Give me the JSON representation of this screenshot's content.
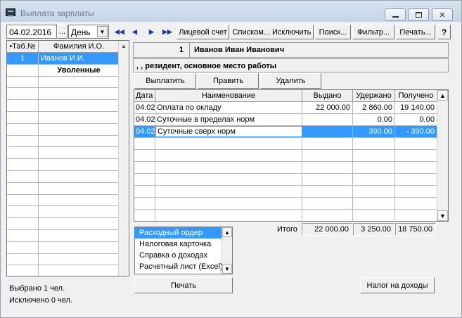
{
  "window": {
    "title": "Выплата зарплаты",
    "close_glyph": "✕"
  },
  "toolbar": {
    "date": "04.02.2016",
    "dots_label": "...",
    "period": "День",
    "nav_first": "◀◀",
    "nav_prev": "◀",
    "nav_next": "▶",
    "nav_last": "▶▶",
    "account_label": "Лицевой счет",
    "list_label": "Списком... Исключить",
    "search_label": "Поиск...",
    "filter_label": "Фильтр...",
    "print_label": "Печать...",
    "help_label": "?"
  },
  "employees": {
    "col_id": "•Таб.№",
    "col_name": "Фамилия И.О.",
    "rows": [
      {
        "id": "1",
        "name": "Иванов И.И."
      },
      {
        "id": "",
        "name": "Уволенные"
      }
    ],
    "status_selected": "Выбрано 1 чел.",
    "status_excluded": "Исключено 0 чел."
  },
  "employee": {
    "id": "1",
    "name": "Иванов Иван Иванович",
    "status": ", , резидент, основное место работы"
  },
  "actions": {
    "pay": "Выплатить",
    "edit": "Править",
    "delete": "Удалить"
  },
  "payments": {
    "col_date": "Дата",
    "col_name": "Наименование",
    "col_out": "Выдано",
    "col_held": "Удержано",
    "col_got": "Получено",
    "rows": [
      {
        "date": "04.02",
        "name": "Оплата по окладу",
        "out": "22 000.00",
        "held": "2 860.00",
        "got": "19 140.00"
      },
      {
        "date": "04.02",
        "name": "Суточные в пределах норм",
        "out": "",
        "held": "0.00",
        "got": "0.00"
      },
      {
        "date": "04.02",
        "name": "Суточные сверх норм",
        "out": "",
        "held": "390.00",
        "got": "- 390.00"
      }
    ],
    "totals_label": "Итого",
    "total_out": "22 000.00",
    "total_held": "3 250.00",
    "total_got": "18 750.00"
  },
  "documents": {
    "items": [
      "Расходный ордер",
      "Налоговая карточка",
      "Справка о доходах",
      "Расчетный лист (Excel)"
    ]
  },
  "bottom": {
    "print_label": "Печать",
    "tax_label": "Налог на доходы"
  }
}
